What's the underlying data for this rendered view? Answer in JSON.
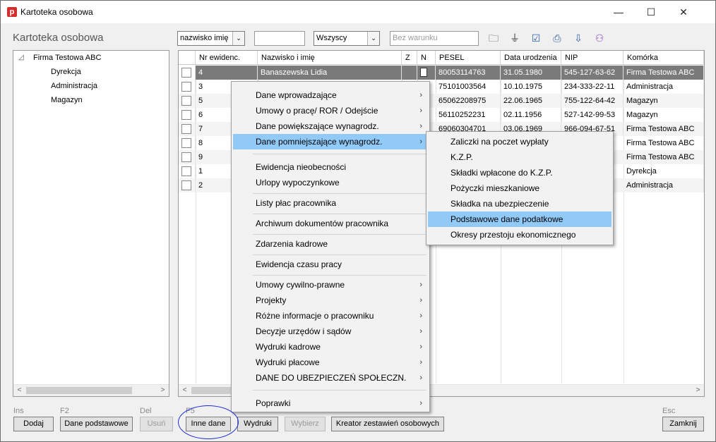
{
  "window": {
    "title": "Kartoteka osobowa",
    "app_icon_letter": "p",
    "minimize": "—",
    "maximize": "☐",
    "close": "✕"
  },
  "page_title": "Kartoteka osobowa",
  "toolbar": {
    "sort_select": "nazwisko imię",
    "search_value": "",
    "filter_select": "Wszyscy",
    "condition_placeholder": "Bez warunku",
    "dropdown_arrow": "⌄",
    "icons": {
      "folder": "🗀",
      "filter": "⏚",
      "check": "☑",
      "print": "⎙",
      "export": "⇩",
      "users": "⚇"
    }
  },
  "tree": {
    "root_toggle": "◿",
    "root": "Firma Testowa ABC",
    "children": [
      "Dyrekcja",
      "Administracja",
      "Magazyn"
    ]
  },
  "grid": {
    "columns": [
      "Nr ewidenc.",
      "Nazwisko i imię",
      "Z",
      "N",
      "PESEL",
      "Data urodzenia",
      "NIP",
      "Komórka"
    ],
    "rows": [
      {
        "nr": "4",
        "name": "Banaszewska Lidia",
        "pesel": "80053114763",
        "dob": "31.05.1980",
        "nip": "545-127-63-62",
        "unit": "Firma Testowa ABC"
      },
      {
        "nr": "3",
        "name": "",
        "pesel": "75101003564",
        "dob": "10.10.1975",
        "nip": "234-333-22-11",
        "unit": "Administracja"
      },
      {
        "nr": "5",
        "name": "",
        "pesel": "65062208975",
        "dob": "22.06.1965",
        "nip": "755-122-64-42",
        "unit": "Magazyn"
      },
      {
        "nr": "6",
        "name": "",
        "pesel": "56110252231",
        "dob": "02.11.1956",
        "nip": "527-142-99-53",
        "unit": "Magazyn"
      },
      {
        "nr": "7",
        "name": "",
        "pesel": "69060304701",
        "dob": "03.06.1969",
        "nip": "966-094-67-51",
        "unit": "Firma Testowa ABC"
      },
      {
        "nr": "8",
        "name": "",
        "pesel": "",
        "dob": "",
        "nip": "",
        "unit": "Firma Testowa ABC"
      },
      {
        "nr": "9",
        "name": "",
        "pesel": "",
        "dob": "",
        "nip": "",
        "unit": "Firma Testowa ABC"
      },
      {
        "nr": "1",
        "name": "",
        "pesel": "",
        "dob": "",
        "nip": "",
        "unit": "Dyrekcja"
      },
      {
        "nr": "2",
        "name": "",
        "pesel": "",
        "dob": "",
        "nip": "",
        "unit": "Administracja"
      }
    ]
  },
  "scroll": {
    "left": "<",
    "right": ">"
  },
  "context_menu": {
    "submenu_arrow": "›",
    "group1": [
      "Dane wprowadzające",
      "Umowy o pracę/ ROR / Odejście",
      "Dane powiększające wynagrodz.",
      "Dane pomniejszające wynagrodz."
    ],
    "group2": [
      "Ewidencja nieobecności",
      "Urlopy wypoczynkowe"
    ],
    "group3": [
      "Listy płac pracownika"
    ],
    "group4": [
      "Archiwum dokumentów pracownika"
    ],
    "group5": [
      "Zdarzenia kadrowe"
    ],
    "group6": [
      "Ewidencja czasu pracy"
    ],
    "group7": [
      "Umowy cywilno-prawne",
      "Projekty",
      "Różne informacje o pracowniku",
      "Decyzje urzędów i sądów",
      "Wydruki kadrowe",
      "Wydruki płacowe",
      "DANE DO UBEZPIECZEŃ SPOŁECZN."
    ],
    "group8": [
      "Poprawki"
    ]
  },
  "submenu": {
    "items": [
      "Zaliczki na poczet wypłaty",
      "K.Z.P.",
      "Składki wpłacone do K.Z.P.",
      "Pożyczki mieszkaniowe",
      "Składka na ubezpieczenie",
      "Podstawowe dane podatkowe",
      "Okresy przestoju ekonomicznego"
    ]
  },
  "footer": {
    "keys": {
      "ins": "Ins",
      "f2": "F2",
      "del": "Del",
      "f5": "F5",
      "esc": "Esc"
    },
    "buttons": {
      "add": "Dodaj",
      "basic": "Dane podstawowe",
      "delete": "Usuń",
      "other": "Inne dane",
      "prints": "Wydruki",
      "choose": "Wybierz",
      "creator": "Kreator zestawień osobowych",
      "close": "Zamknij"
    }
  }
}
